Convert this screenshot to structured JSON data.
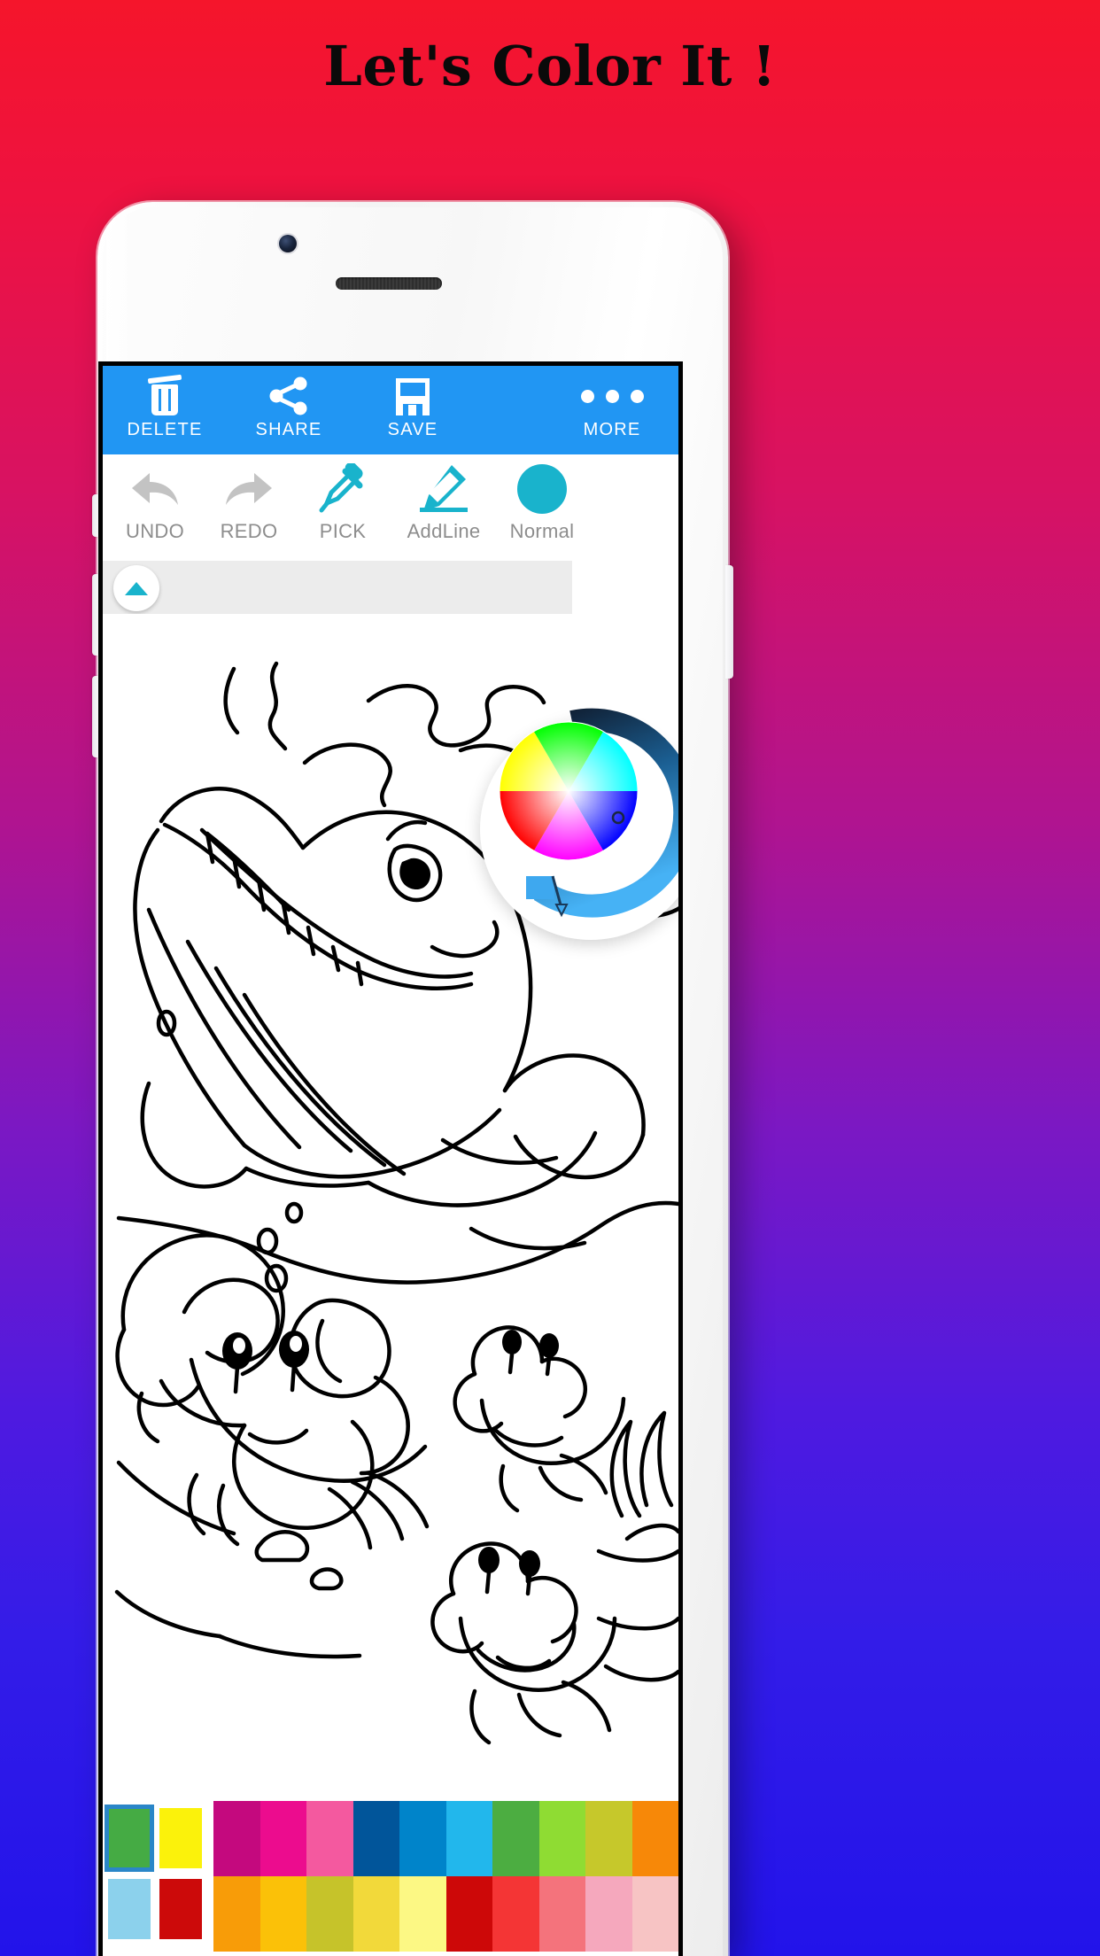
{
  "headline": "Let's Color It !",
  "background": {
    "top_color": "#f5152b",
    "bottom_color": "#2213ea"
  },
  "app": {
    "toolbar": {
      "bg_color": "#2196f3",
      "items": [
        {
          "label": "DELETE",
          "icon": "trash-icon"
        },
        {
          "label": "SHARE",
          "icon": "share-icon"
        },
        {
          "label": "SAVE",
          "icon": "floppy-disk-icon"
        },
        {
          "label": "MORE",
          "icon": "more-dots-icon"
        }
      ]
    },
    "tools": {
      "accent_color": "#19b3cc",
      "disabled_color": "#c3c3c3",
      "items": [
        {
          "label": "UNDO",
          "icon": "undo-arrow-icon",
          "enabled": false
        },
        {
          "label": "REDO",
          "icon": "redo-arrow-icon",
          "enabled": false
        },
        {
          "label": "PICK",
          "icon": "eyedropper-icon",
          "enabled": true
        },
        {
          "label": "AddLine",
          "icon": "pencil-icon",
          "enabled": true
        },
        {
          "label": "Normal",
          "icon": "brush-mode-circle-icon",
          "enabled": true
        }
      ]
    },
    "color_wheel": {
      "type": "hsv-wheel",
      "brightness_arc_start": "#16243c",
      "brightness_arc_end": "#3ea8ef",
      "selector_position": "lower-right"
    },
    "canvas": {
      "artwork": "underwater-whale-and-crabs-coloring-page",
      "line_color": "#000000",
      "fill_color": "#ffffff"
    },
    "palette": {
      "special": [
        {
          "color": "#45ab44",
          "selected": true
        },
        {
          "color": "#8cd1ec",
          "selected": false
        },
        {
          "color": "#fbf20b",
          "selected": false
        },
        {
          "color": "#cc0a0a",
          "selected": false
        }
      ],
      "columns": [
        {
          "top": "#c4097e",
          "bottom": "#f89c08"
        },
        {
          "top": "#ec0c8e",
          "bottom": "#fbc108"
        },
        {
          "top": "#f4599f",
          "bottom": "#c6c32a"
        },
        {
          "top": "#01559a",
          "bottom": "#f2d93a"
        },
        {
          "top": "#0084ca",
          "bottom": "#fcf884"
        },
        {
          "top": "#22b7ec",
          "bottom": "#cd0808"
        },
        {
          "top": "#4cad41",
          "bottom": "#f43535"
        },
        {
          "top": "#8fdc33",
          "bottom": "#f4737c"
        },
        {
          "top": "#c6c82b",
          "bottom": "#f5a8bd"
        },
        {
          "top": "#f78808",
          "bottom": "#f7c4c4"
        }
      ]
    }
  }
}
